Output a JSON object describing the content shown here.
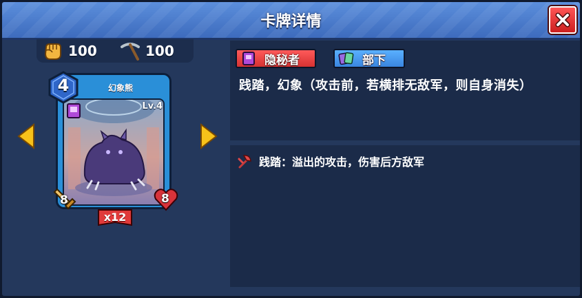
{
  "window": {
    "title": "卡牌详情"
  },
  "resources": [
    {
      "icon": "fist-icon",
      "value": "100"
    },
    {
      "icon": "pickaxe-icon",
      "value": "100"
    }
  ],
  "card": {
    "name": "幻象熊",
    "cost": "4",
    "level": "Lv.4",
    "attack": "8",
    "health": "8",
    "count": "x12"
  },
  "tags": [
    {
      "label": "隐秘者",
      "icon": "purple-book-icon",
      "color": "#e23a3a"
    },
    {
      "label": "部下",
      "icon": "cards-icon",
      "color": "#4a9cf0"
    }
  ],
  "description": "践踏，幻象（攻击前，若横排无敌军，则自身消失）",
  "abilities": [
    {
      "icon": "axe-icon",
      "text": "践踏：溢出的攻击，伤害后方敌军"
    }
  ],
  "colors": {
    "titlebar": "#4a7dd0",
    "panel": "#24385c",
    "close": "#e83333",
    "arrow": "#f7c21a",
    "card_frame": "#2a8fd8"
  }
}
